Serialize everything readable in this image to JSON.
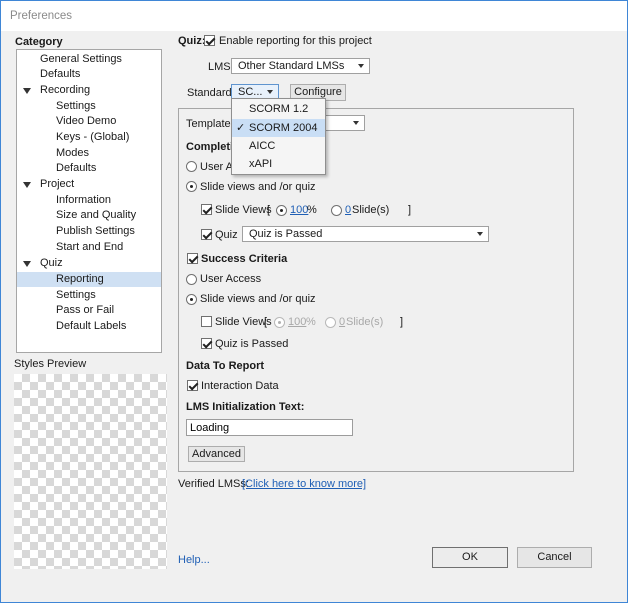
{
  "window": {
    "title": "Preferences"
  },
  "category": {
    "heading": "Category",
    "items": [
      {
        "label": "General Settings"
      },
      {
        "label": "Defaults"
      },
      {
        "label": "Recording"
      },
      {
        "label": "Settings"
      },
      {
        "label": "Video Demo"
      },
      {
        "label": "Keys - (Global)"
      },
      {
        "label": "Modes"
      },
      {
        "label": "Defaults"
      },
      {
        "label": "Project"
      },
      {
        "label": "Information"
      },
      {
        "label": "Size and Quality"
      },
      {
        "label": "Publish Settings"
      },
      {
        "label": "Start and End"
      },
      {
        "label": "Quiz"
      },
      {
        "label": "Reporting"
      },
      {
        "label": "Settings"
      },
      {
        "label": "Pass or Fail"
      },
      {
        "label": "Default Labels"
      }
    ],
    "selected": "Reporting"
  },
  "styles_preview": {
    "label": "Styles Preview"
  },
  "quiz": {
    "label": "Quiz:",
    "enable_reporting": {
      "label": "Enable reporting for this project",
      "checked": true
    }
  },
  "lms": {
    "label": "LMS:",
    "value": "Other Standard LMSs"
  },
  "standard": {
    "label": "Standard:",
    "value": "SC...",
    "configure_label": "Configure",
    "options": [
      "SCORM 1.2",
      "SCORM 2004",
      "AICC",
      "xAPI"
    ],
    "selected_option": "SCORM 2004",
    "check_glyph": "✓"
  },
  "template": {
    "label": "Template:"
  },
  "completion": {
    "heading": "Completi",
    "user_access_label": "User Ac",
    "slide_views_quiz_label": "Slide views and /or quiz",
    "slide_views": {
      "label": "Slide Views",
      "bracket_open": "[",
      "bracket_close": "]",
      "percent_value": "100",
      "percent_unit": "%",
      "slides_value": "0",
      "slides_unit": "Slide(s)"
    },
    "quiz_label": "Quiz",
    "quiz_select_value": "Quiz is Passed"
  },
  "success": {
    "heading": "Success Criteria",
    "user_access_label": "User Access",
    "slide_views_quiz_label": "Slide views and /or quiz",
    "slide_views": {
      "label": "Slide Views",
      "bracket_open": "[",
      "bracket_close": "]",
      "percent_value": "100",
      "percent_unit": "%",
      "slides_value": "0",
      "slides_unit": "Slide(s)"
    },
    "quiz_passed_label": "Quiz is Passed"
  },
  "data_to_report": {
    "heading": "Data To Report",
    "interaction_data_label": "Interaction Data"
  },
  "lms_init": {
    "heading": "LMS Initialization Text:",
    "value": "Loading"
  },
  "advanced_label": "Advanced",
  "verified": {
    "label": "Verified LMSs:",
    "link": "[Click here to know more]"
  },
  "help_label": "Help...",
  "ok_label": "OK",
  "cancel_label": "Cancel"
}
